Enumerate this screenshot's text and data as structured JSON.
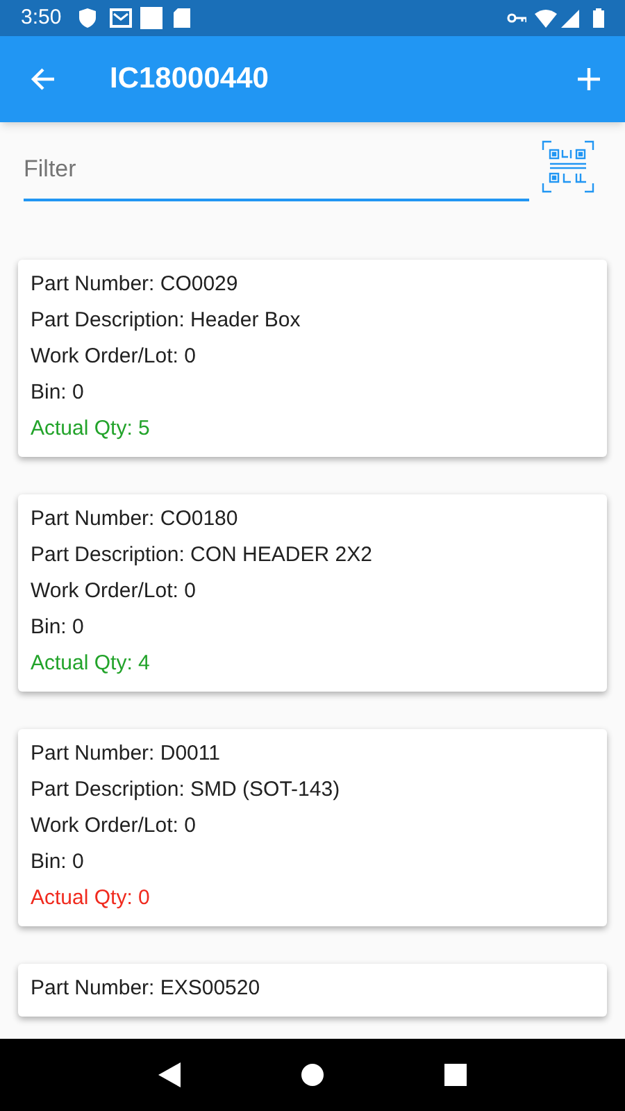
{
  "status_bar": {
    "time": "3:50"
  },
  "app_bar": {
    "title": "IC18000440"
  },
  "filter": {
    "placeholder": "Filter"
  },
  "cards": [
    {
      "lines": [
        "Part Number: CO0029",
        "Part Description: Header Box",
        "Work Order/Lot: 0",
        "Bin: 0"
      ],
      "qty": "Actual Qty: 5",
      "color": "#22a32a"
    },
    {
      "lines": [
        "Part Number: CO0180",
        "Part Description: CON HEADER 2X2",
        "Work Order/Lot: 0",
        "Bin: 0"
      ],
      "qty": "Actual Qty: 4",
      "color": "#22a32a"
    },
    {
      "lines": [
        "Part Number: D0011",
        "Part Description: SMD (SOT-143)",
        "Work Order/Lot: 0",
        "Bin: 0"
      ],
      "qty": "Actual Qty: 0",
      "color": "#f02a1e"
    },
    {
      "lines": [
        "Part Number: EXS00520"
      ]
    }
  ]
}
